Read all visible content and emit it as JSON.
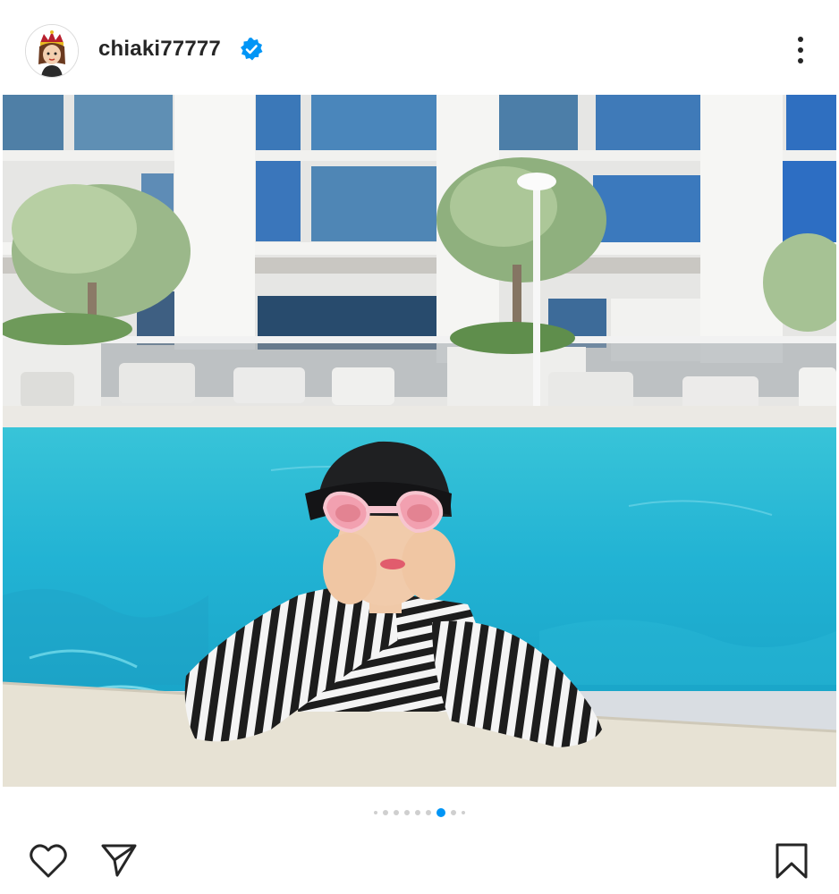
{
  "post": {
    "username": "chiaki77777",
    "verified": true,
    "avatar_icon": "avatar-illustration-icon",
    "more_icon": "more-vertical-icon"
  },
  "carousel": {
    "total": 9,
    "active_index": 6
  },
  "actions": {
    "like_icon": "heart-icon",
    "share_icon": "send-icon",
    "save_icon": "bookmark-icon"
  },
  "colors": {
    "verified_blue": "#0095f6",
    "active_dot": "#0095f6",
    "inactive_dot": "#cfcfcf"
  }
}
